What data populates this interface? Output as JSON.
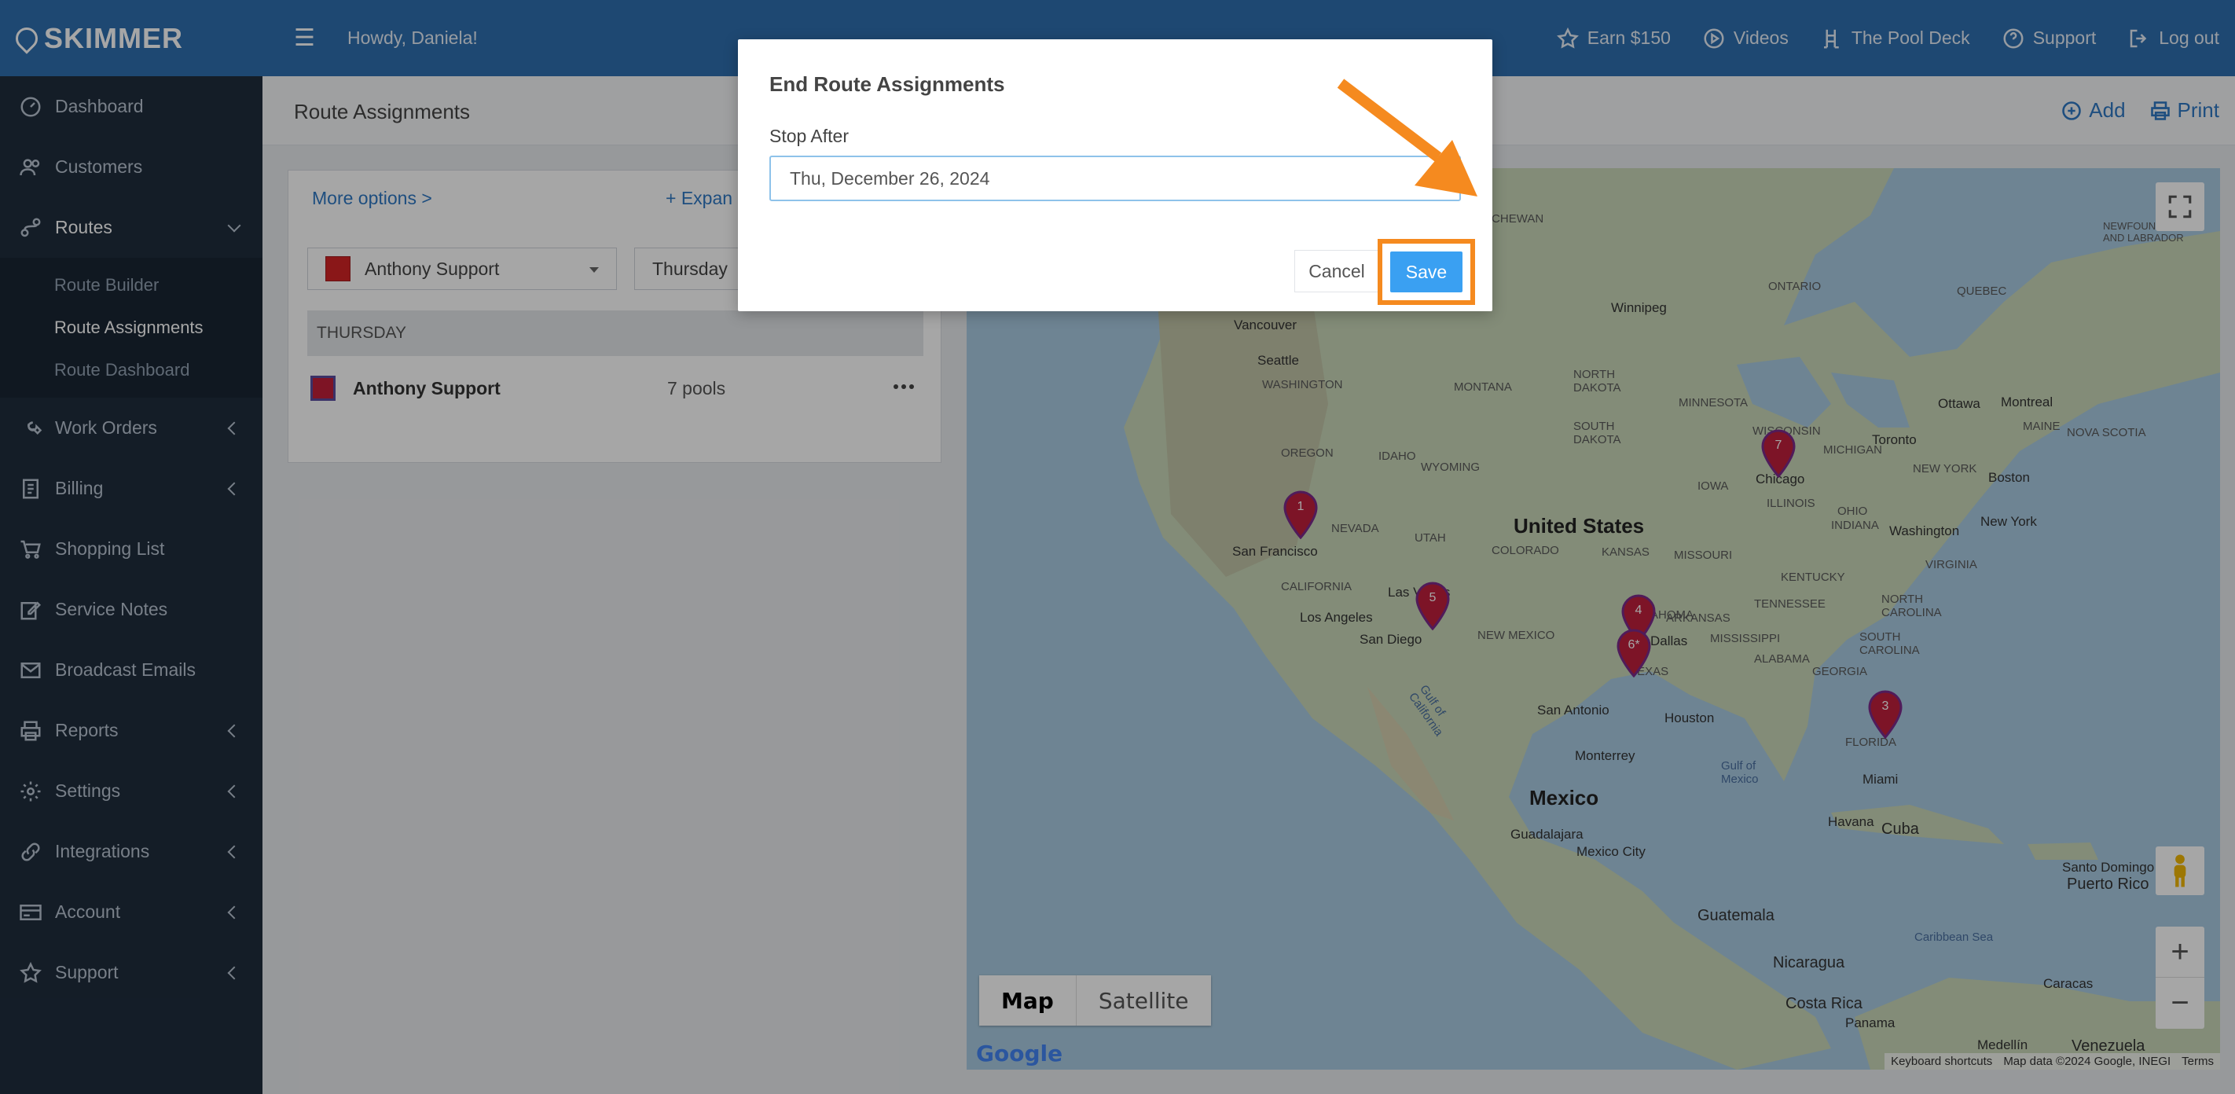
{
  "brand": {
    "name": "SKIMMER"
  },
  "topbar": {
    "greeting": "Howdy, Daniela!",
    "links": [
      {
        "label": "Earn $150",
        "icon": "star-icon"
      },
      {
        "label": "Videos",
        "icon": "play-icon"
      },
      {
        "label": "The Pool Deck",
        "icon": "chair-icon"
      },
      {
        "label": "Support",
        "icon": "help-icon"
      },
      {
        "label": "Log out",
        "icon": "logout-icon"
      }
    ]
  },
  "sidebar": {
    "items": [
      {
        "label": "Dashboard",
        "icon": "gauge-icon"
      },
      {
        "label": "Customers",
        "icon": "users-icon"
      },
      {
        "label": "Routes",
        "icon": "route-icon",
        "expanded": true
      },
      {
        "label": "Work Orders",
        "icon": "wrench-icon"
      },
      {
        "label": "Billing",
        "icon": "invoice-icon"
      },
      {
        "label": "Shopping List",
        "icon": "cart-icon"
      },
      {
        "label": "Service Notes",
        "icon": "edit-icon"
      },
      {
        "label": "Broadcast Emails",
        "icon": "mail-icon"
      },
      {
        "label": "Reports",
        "icon": "printer-icon"
      },
      {
        "label": "Settings",
        "icon": "gear-icon"
      },
      {
        "label": "Integrations",
        "icon": "link-icon"
      },
      {
        "label": "Account",
        "icon": "card-icon"
      },
      {
        "label": "Support",
        "icon": "star-icon"
      }
    ],
    "routes_sub": [
      "Route Builder",
      "Route Assignments",
      "Route Dashboard"
    ]
  },
  "page": {
    "title": "Route Assignments",
    "add_label": "Add",
    "print_label": "Print"
  },
  "panel": {
    "more_options": "More options >",
    "expand": "Expan",
    "route_select": "Anthony Support",
    "day_select": "Thursday",
    "day_header": "THURSDAY",
    "row": {
      "name": "Anthony Support",
      "pools": "7 pools"
    }
  },
  "map": {
    "type_map": "Map",
    "type_satellite": "Satellite",
    "zoom_in": "+",
    "zoom_out": "−",
    "google": "Google",
    "attribution": [
      "Keyboard shortcuts",
      "Map data ©2024 Google, INEGI",
      "Terms"
    ],
    "labels": [
      "Vancouver",
      "Seattle",
      "WASHINGTON",
      "OREGON",
      "IDAHO",
      "MONTANA",
      "NORTH DAKOTA",
      "SOUTH DAKOTA",
      "WYOMING",
      "NEVADA",
      "UTAH",
      "COLORADO",
      "San Francisco",
      "CALIFORNIA",
      "Los Angeles",
      "San Diego",
      "Las Vegas",
      "NEW MEXICO",
      "United States",
      "KANSAS",
      "MISSOURI",
      "IOWA",
      "MINNESOTA",
      "WISCONSIN",
      "ILLINOIS",
      "INDIANA",
      "OHIO",
      "MICHIGAN",
      "Chicago",
      "Winnipeg",
      "ONTARIO",
      "QUEBEC",
      "Ottawa",
      "Montreal",
      "Toronto",
      "NEW YORK",
      "Boston",
      "New York",
      "Washington",
      "KENTUCKY",
      "TENNESSEE",
      "ARKANSAS",
      "MISSISSIPPI",
      "ALABAMA",
      "GEORGIA",
      "NORTH CAROLINA",
      "SOUTH CAROLINA",
      "FLORIDA",
      "Miami",
      "Houston",
      "San Antonio",
      "Mexico",
      "Monterrey",
      "Guadalajara",
      "Mexico City",
      "Havana",
      "Cuba",
      "Gulf of Mexico",
      "Guatemala",
      "Nicaragua",
      "Costa Rica",
      "Panama",
      "Caribbean Sea",
      "Caracas",
      "Medellín",
      "Venezuela",
      "Santo Domingo",
      "Puerto Rico",
      "MAINE",
      "NOVA SCOTIA",
      "NEWFOUNDLAND AND LABRADOR",
      "KATCHEWAN",
      "Gulf of California",
      "OKLAHOMA",
      "TEXAS",
      "Dallas",
      "VIRGINIA"
    ],
    "pins": [
      "1",
      "5",
      "4",
      "6*",
      "3",
      "7"
    ]
  },
  "modal": {
    "title": "End Route Assignments",
    "field_label": "Stop After",
    "date_value": "Thu, December 26, 2024",
    "cancel": "Cancel",
    "save": "Save"
  },
  "colors": {
    "topbar": "#2f6fb0",
    "sidebar": "#1f2d3d",
    "route_swatch": "#d42426",
    "save": "#3aa0f2",
    "highlight": "#f58a1f"
  }
}
